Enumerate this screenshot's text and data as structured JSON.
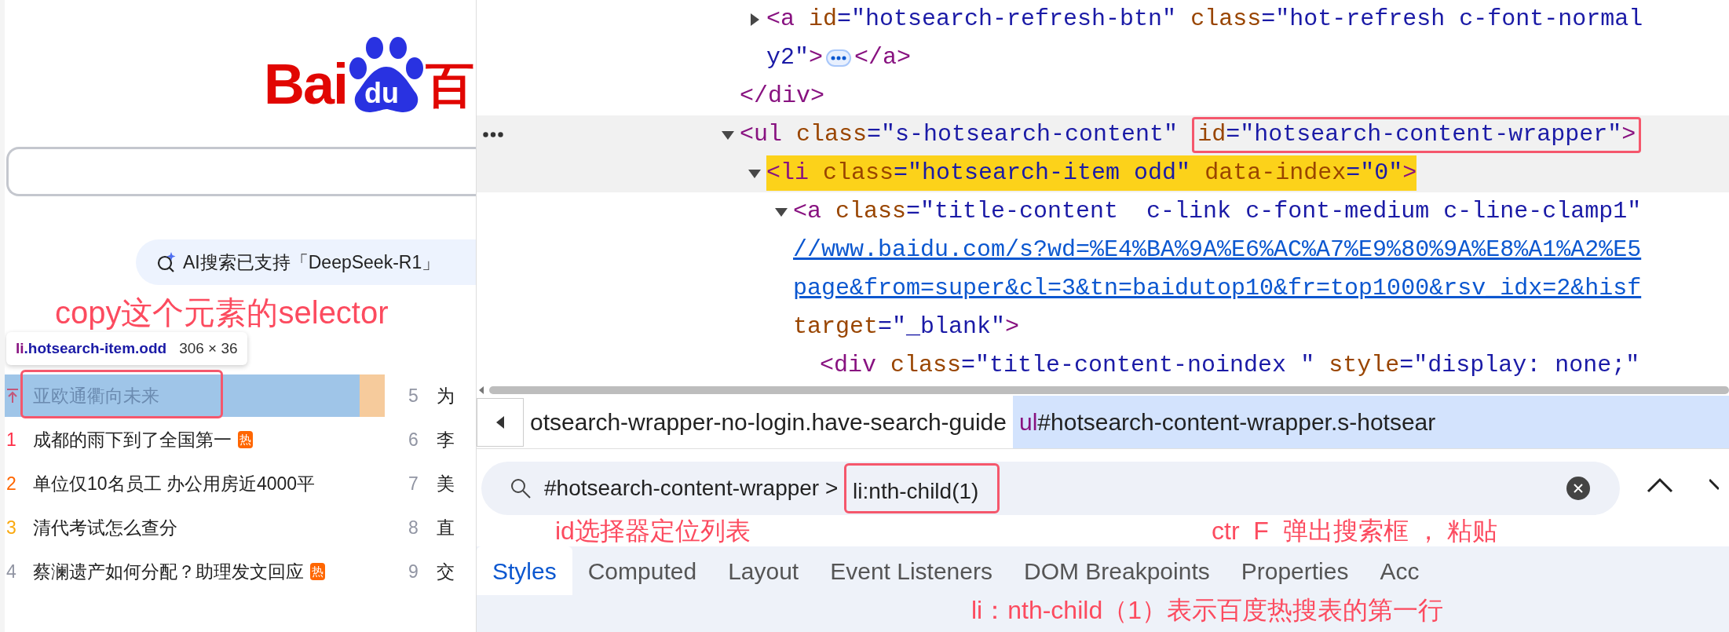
{
  "page": {
    "logo": {
      "left": "Bai",
      "paw": "du",
      "right": "百"
    },
    "ai_pill": "AI搜索已支持「DeepSeek-R1」",
    "annotation": "copy这个元素的selector",
    "tooltip": {
      "tag": "li",
      "classes": ".hotsearch-item.odd",
      "size": "306 × 36"
    },
    "hot_list": [
      {
        "kind": "pinned",
        "title": "亚欧通衢向未来",
        "highlighted": true,
        "annotated": true,
        "color": "#c3587a"
      },
      {
        "kind": "ranked",
        "rank": "1",
        "title": "成都的雨下到了全国第一",
        "badge": "热",
        "highlighted": false,
        "annotated": false,
        "color": "#fe2d46"
      },
      {
        "kind": "ranked",
        "rank": "2",
        "title": "单位仅10名员工 办公用房近4000平",
        "highlighted": false,
        "annotated": false,
        "color": "#ff6600"
      },
      {
        "kind": "ranked",
        "rank": "3",
        "title": "清代考试怎么查分",
        "highlighted": false,
        "annotated": false,
        "color": "#faa90e"
      },
      {
        "kind": "ranked",
        "rank": "4",
        "title": "蔡澜遗产如何分配？助理发文回应",
        "badge": "热",
        "highlighted": false,
        "annotated": false,
        "color": "#9195a3"
      }
    ],
    "hot_list_right": [
      {
        "rank": "5",
        "title": "为"
      },
      {
        "rank": "6",
        "title": "李"
      },
      {
        "rank": "7",
        "title": "美"
      },
      {
        "rank": "8",
        "title": "直"
      },
      {
        "rank": "9",
        "title": "交"
      }
    ]
  },
  "devtools": {
    "dom_tree": [
      {
        "children": [
          {
            "expanded": false,
            "hovered": false,
            "match": false,
            "lines": [
              [
                {
                  "kind": "tag",
                  "s": "<a"
                },
                {
                  "kind": "attr",
                  "s": " id"
                },
                {
                  "kind": "punct",
                  "s": "="
                },
                {
                  "kind": "val",
                  "s": "\"hotsearch-refresh-btn\""
                },
                {
                  "kind": "attr",
                  "s": " class"
                },
                {
                  "kind": "punct",
                  "s": "="
                },
                {
                  "kind": "val",
                  "s": "\"hot-refresh c-font-normal"
                }
              ],
              [
                {
                  "kind": "val",
                  "s": "y2\""
                },
                {
                  "kind": "tag",
                  "s": ">"
                },
                {
                  "kind": "ellipsis"
                },
                {
                  "kind": "tag",
                  "s": "</a>"
                }
              ]
            ]
          }
        ],
        "closing": [
          {
            "kind": "tag",
            "s": "</div>"
          }
        ]
      },
      {
        "expanded": true,
        "hovered": true,
        "match": false,
        "lines": [
          [
            {
              "kind": "tag",
              "s": "<ul"
            },
            {
              "kind": "attr",
              "s": " class"
            },
            {
              "kind": "punct",
              "s": "="
            },
            {
              "kind": "val",
              "s": "\"s-hotsearch-content\" "
            },
            {
              "kind": "attr",
              "s": "id",
              "boxed": true
            },
            {
              "kind": "punct",
              "s": "=",
              "boxed": true
            },
            {
              "kind": "val",
              "s": "\"hotsearch-content-wrapper\"",
              "boxed": true
            },
            {
              "kind": "tag",
              "s": ">",
              "boxed": true
            }
          ]
        ],
        "children": [
          {
            "expanded": true,
            "hovered": true,
            "match": true,
            "lines": [
              [
                {
                  "kind": "tag",
                  "s": "<li"
                },
                {
                  "kind": "attr",
                  "s": " class"
                },
                {
                  "kind": "punct",
                  "s": "="
                },
                {
                  "kind": "val",
                  "s": "\"hotsearch-item odd\""
                },
                {
                  "kind": "attr",
                  "s": " data-index"
                },
                {
                  "kind": "punct",
                  "s": "="
                },
                {
                  "kind": "val",
                  "s": "\"0\""
                },
                {
                  "kind": "tag",
                  "s": ">"
                }
              ]
            ],
            "children": [
              {
                "expanded": true,
                "hovered": false,
                "match": false,
                "lines": [
                  [
                    {
                      "kind": "tag",
                      "s": "<a"
                    },
                    {
                      "kind": "attr",
                      "s": " class"
                    },
                    {
                      "kind": "punct",
                      "s": "="
                    },
                    {
                      "kind": "val",
                      "s": "\"title-content  c-link c-font-medium c-line-clamp1\""
                    }
                  ],
                  [
                    {
                      "kind": "link",
                      "s": "//www.baidu.com/s?wd=%E4%BA%9A%E6%AC%A7%E9%80%9A%E8%A1%A2%E5"
                    }
                  ],
                  [
                    {
                      "kind": "link",
                      "s": "page&from=super&cl=3&tn=baidutop10&fr=top1000&rsv_idx=2&hisf"
                    }
                  ],
                  [
                    {
                      "kind": "attr",
                      "s": "target"
                    },
                    {
                      "kind": "punct",
                      "s": "="
                    },
                    {
                      "kind": "val",
                      "s": "\"_blank\""
                    },
                    {
                      "kind": "tag",
                      "s": ">"
                    }
                  ]
                ],
                "children": [
                  {
                    "hovered": false,
                    "match": false,
                    "lines": [
                      [
                        {
                          "kind": "tag",
                          "s": "<div"
                        },
                        {
                          "kind": "attr",
                          "s": " class"
                        },
                        {
                          "kind": "punct",
                          "s": "="
                        },
                        {
                          "kind": "val",
                          "s": "\"title-content-noindex \""
                        },
                        {
                          "kind": "attr",
                          "s": " style"
                        },
                        {
                          "kind": "punct",
                          "s": "="
                        },
                        {
                          "kind": "val",
                          "s": "\"display: none;\""
                        }
                      ]
                    ]
                  }
                ]
              }
            ]
          }
        ]
      }
    ],
    "breadcrumbs": [
      {
        "text": "otsearch-wrapper-no-login.have-search-guide",
        "selected": false
      },
      {
        "text": "#hotsearch-content-wrapper.s-hotsear",
        "tag": "ul",
        "selected": true
      }
    ],
    "search": {
      "value_parts": [
        {
          "text": "#hotsearch-content-wrapper > ",
          "boxed": false
        },
        {
          "text": "li:nth-child(1)",
          "boxed": true
        }
      ]
    },
    "annotations": {
      "search_hint": "ctr  F  弹出搜索框 ， 粘贴",
      "id_selector": "id选择器定位列表",
      "nth_child": "li：nth-child（1）表示百度热搜表的第一行"
    },
    "tabs": [
      {
        "label": "Styles",
        "selected": true
      },
      {
        "label": "Computed",
        "selected": false
      },
      {
        "label": "Layout",
        "selected": false
      },
      {
        "label": "Event Listeners",
        "selected": false
      },
      {
        "label": "DOM Breakpoints",
        "selected": false
      },
      {
        "label": "Properties",
        "selected": false
      },
      {
        "label": "Acc",
        "selected": false
      }
    ]
  }
}
